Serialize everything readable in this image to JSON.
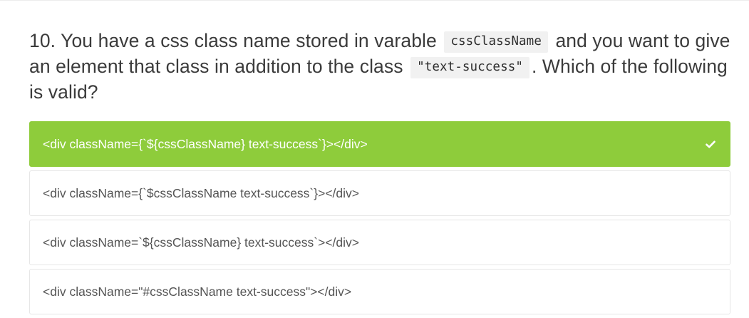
{
  "question": {
    "number": "10.",
    "text_part1": "You have a css class name stored in varable",
    "code1": "cssClassName",
    "text_part2": "and you want to give an element that class in addition to the class",
    "code2": "\"text-success\"",
    "text_part3": ". Which of the following is valid?"
  },
  "options": [
    {
      "label": "<div className={`${cssClassName} text-success`}></div>",
      "selected": true,
      "status_icon": "check-icon"
    },
    {
      "label": "<div className={`$cssClassName text-success`}></div>",
      "selected": false
    },
    {
      "label": "<div className=`${cssClassName} text-success`></div>",
      "selected": false
    },
    {
      "label": "<div className=\"#cssClassName text-success\"></div>",
      "selected": false
    }
  ],
  "colors": {
    "correct": "#8ecc3b",
    "text": "#3b3b3b",
    "border": "#e6e6e6"
  }
}
